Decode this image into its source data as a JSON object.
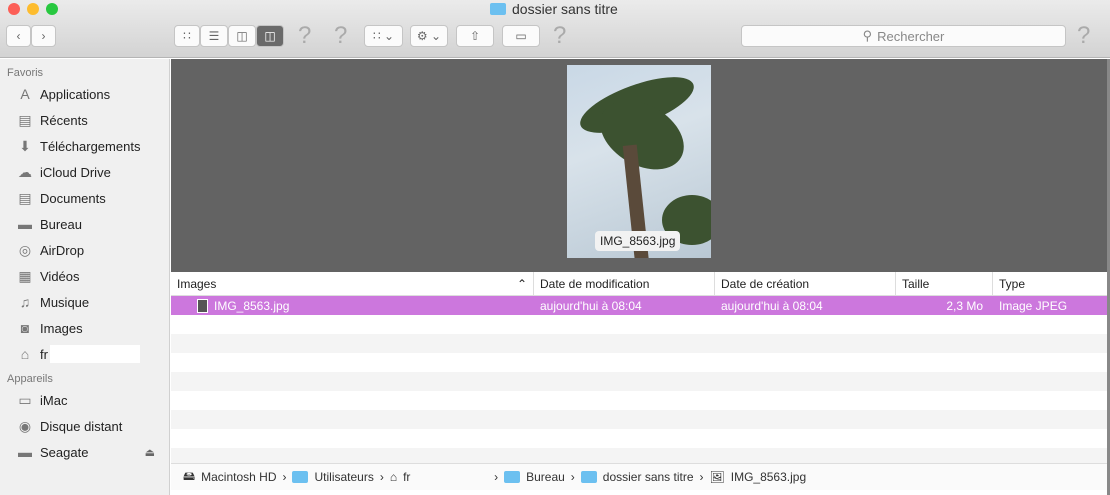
{
  "window": {
    "title": "dossier sans titre"
  },
  "toolbar": {
    "search_placeholder": "Rechercher",
    "view_modes": [
      "icons",
      "list",
      "columns",
      "cover-flow"
    ],
    "active_view": "cover-flow"
  },
  "sidebar": {
    "favorites_label": "Favoris",
    "favorites": [
      {
        "label": "Applications",
        "icon": "applications-icon"
      },
      {
        "label": "Récents",
        "icon": "recents-icon"
      },
      {
        "label": "Téléchargements",
        "icon": "downloads-icon"
      },
      {
        "label": "iCloud Drive",
        "icon": "cloud-icon"
      },
      {
        "label": "Documents",
        "icon": "documents-icon"
      },
      {
        "label": "Bureau",
        "icon": "desktop-icon"
      },
      {
        "label": "AirDrop",
        "icon": "airdrop-icon"
      },
      {
        "label": "Vidéos",
        "icon": "videos-icon"
      },
      {
        "label": "Musique",
        "icon": "music-icon"
      },
      {
        "label": "Images",
        "icon": "images-icon"
      },
      {
        "label": "fr",
        "icon": "home-icon"
      }
    ],
    "devices_label": "Appareils",
    "devices": [
      {
        "label": "iMac",
        "icon": "imac-icon"
      },
      {
        "label": "Disque distant",
        "icon": "disc-icon"
      },
      {
        "label": "Seagate",
        "icon": "drive-icon"
      }
    ]
  },
  "preview": {
    "caption": "IMG_8563.jpg"
  },
  "list": {
    "columns": [
      "Images",
      "Date de modification",
      "Date de création",
      "Taille",
      "Type"
    ],
    "rows": [
      {
        "name": "IMG_8563.jpg",
        "modified": "aujourd'hui à 08:04",
        "created": "aujourd'hui à 08:04",
        "size": "2,3 Mo",
        "type": "Image JPEG",
        "selected": true
      }
    ],
    "selection_color": "#cc77dd"
  },
  "pathbar": [
    "Macintosh HD",
    "Utilisateurs",
    "fr",
    "Bureau",
    "dossier sans titre",
    "IMG_8563.jpg"
  ]
}
